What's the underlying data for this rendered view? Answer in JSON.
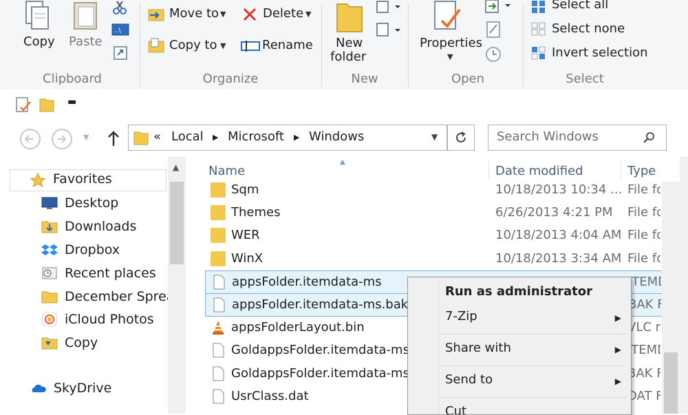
{
  "ribbon": {
    "clipboard": {
      "copy": "Copy",
      "paste": "Paste",
      "group": "Clipboard"
    },
    "organize": {
      "move_to": "Move to",
      "copy_to": "Copy to",
      "delete": "Delete",
      "rename": "Rename",
      "group": "Organize"
    },
    "new": {
      "new_folder_line1": "New",
      "new_folder_line2": "folder",
      "group": "New"
    },
    "open": {
      "properties": "Properties",
      "group": "Open"
    },
    "select": {
      "select_all": "Select all",
      "select_none": "Select none",
      "invert": "Invert selection",
      "group": "Select"
    }
  },
  "address": {
    "overflow": "«",
    "crumbs": [
      "Local",
      "Microsoft",
      "Windows"
    ],
    "search_placeholder": "Search Windows"
  },
  "nav": {
    "items": [
      {
        "label": "Favorites"
      },
      {
        "label": "Desktop"
      },
      {
        "label": "Downloads"
      },
      {
        "label": "Dropbox"
      },
      {
        "label": "Recent places"
      },
      {
        "label": "December Spread"
      },
      {
        "label": "iCloud Photos"
      },
      {
        "label": "Copy"
      },
      {
        "label": "SkyDrive"
      }
    ]
  },
  "files": {
    "columns": {
      "name": "Name",
      "date": "Date modified",
      "type": "Type"
    },
    "rows": [
      {
        "name": "Sqm",
        "date": "10/18/2013 10:34 ...",
        "type": "File fo"
      },
      {
        "name": "Themes",
        "date": "6/26/2013 4:21 PM",
        "type": "File fo"
      },
      {
        "name": "WER",
        "date": "10/18/2013 4:04 AM",
        "type": "File fo"
      },
      {
        "name": "WinX",
        "date": "10/18/2013 3:34 AM",
        "type": "File fo"
      },
      {
        "name": "appsFolder.itemdata-ms",
        "date": "",
        "type": "ITEMD"
      },
      {
        "name": "appsFolder.itemdata-ms.bak",
        "date": "",
        "type": "BAK F"
      },
      {
        "name": "appsFolderLayout.bin",
        "date": "",
        "type": "VLC m"
      },
      {
        "name": "GoldappsFolder.itemdata-ms",
        "date": "",
        "type": "ITEMD"
      },
      {
        "name": "GoldappsFolder.itemdata-ms.l",
        "date": "",
        "type": "BAK F"
      },
      {
        "name": "UsrClass.dat",
        "date": "",
        "type": "DAT F"
      }
    ]
  },
  "context_menu": {
    "run_as_admin": "Run as administrator",
    "seven_zip": "7-Zip",
    "share_with": "Share with",
    "send_to": "Send to",
    "cut": "Cut"
  },
  "colors": {
    "accent": "#3399ff",
    "folder": "#f2c94c",
    "selection": "#e5f3fb"
  }
}
